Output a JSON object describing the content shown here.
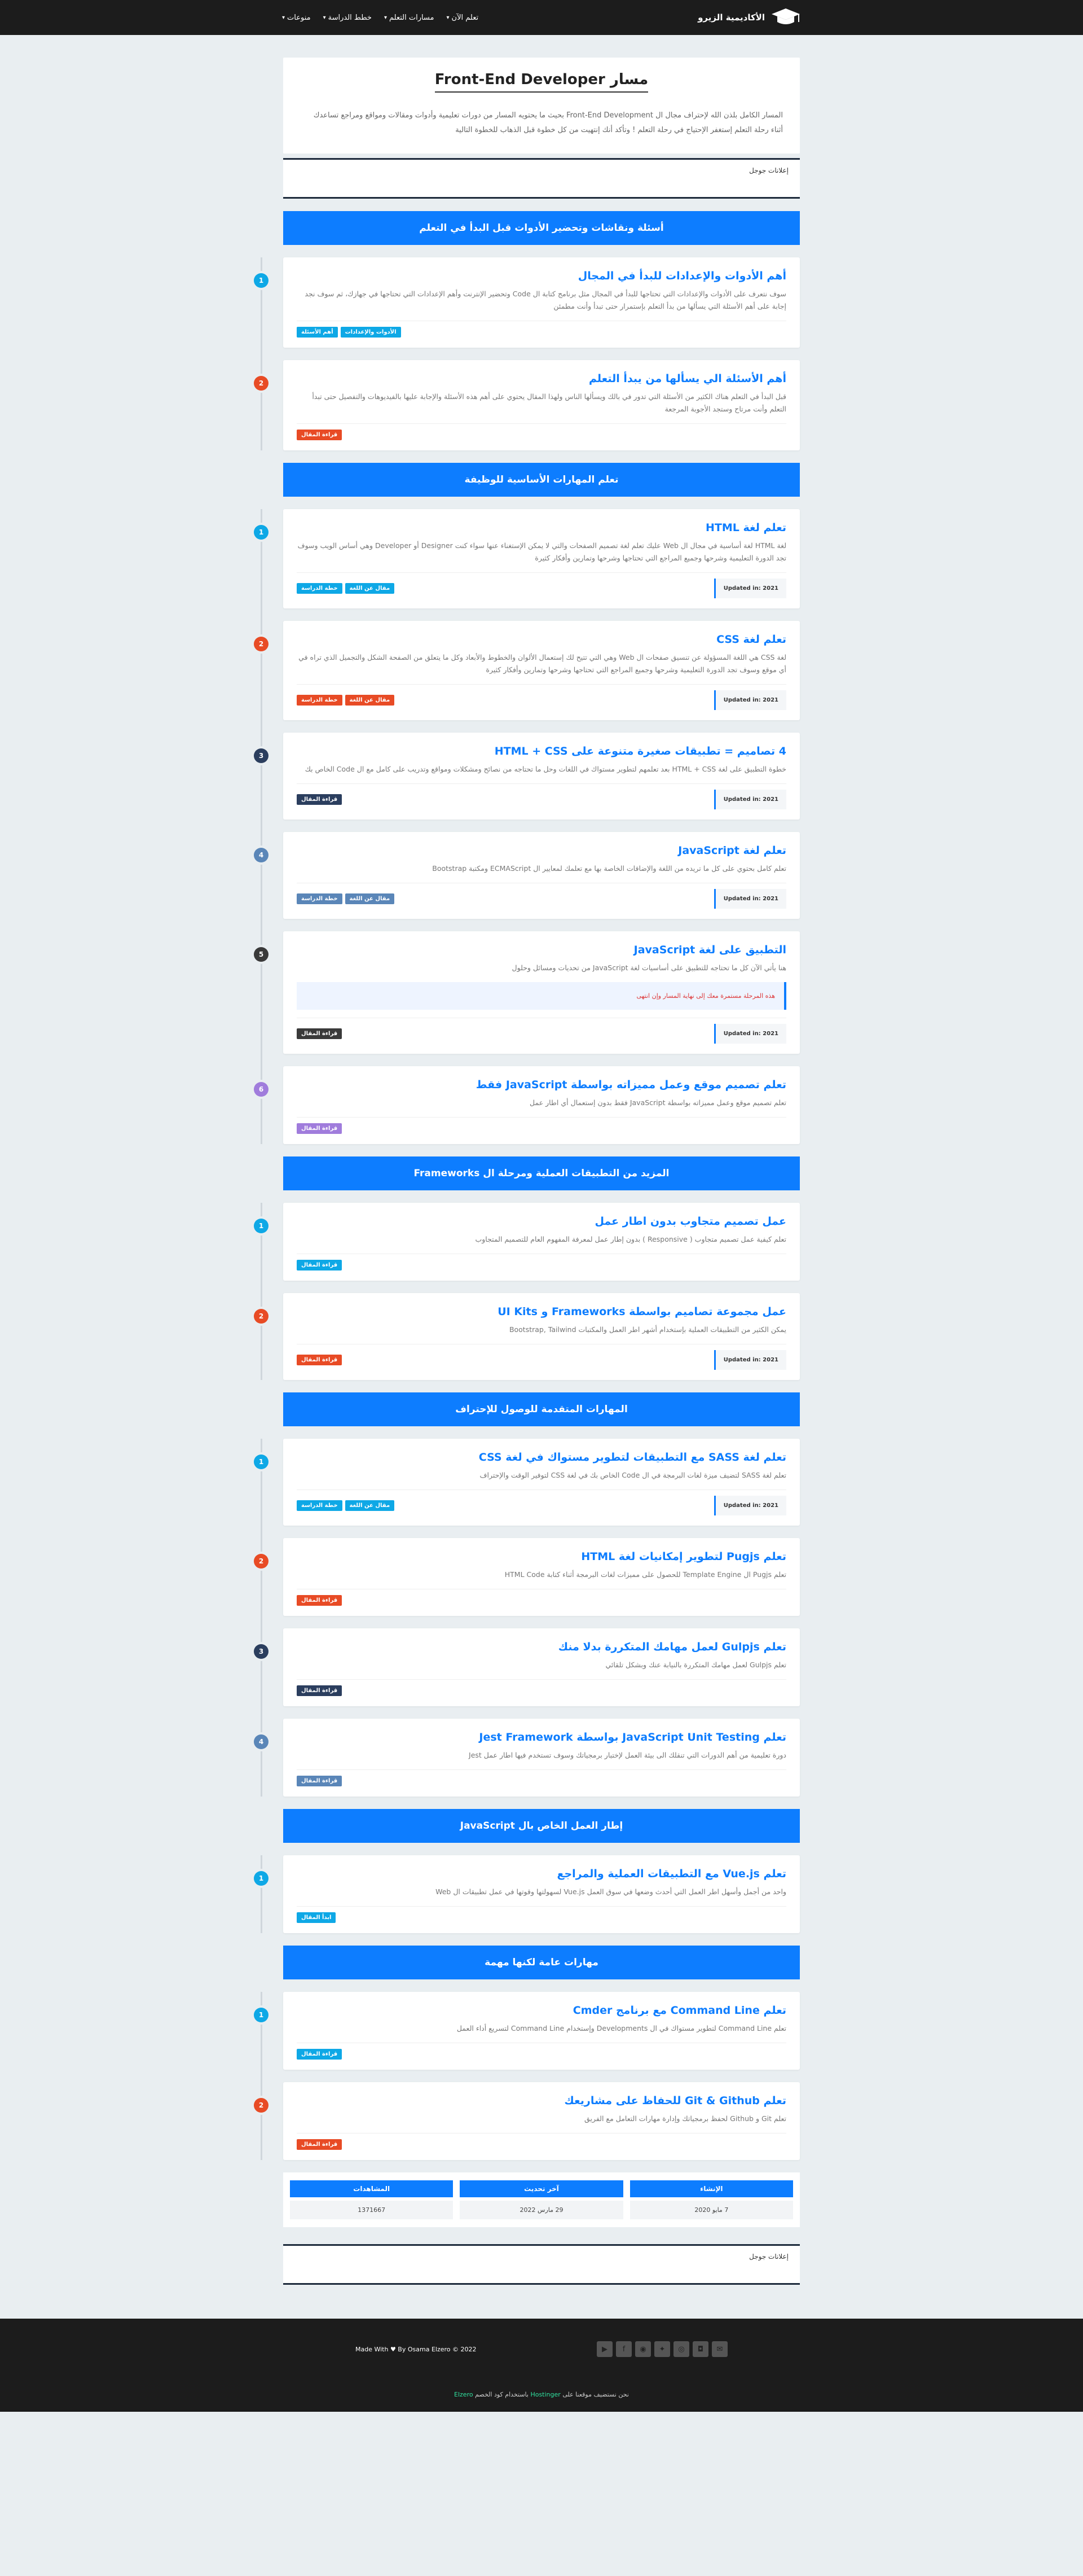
{
  "nav": {
    "brand": "الأكاديمية الزيرو",
    "menu": [
      "تعلم الآن",
      "مسارات التعلم",
      "خطط الدراسة",
      "منوعات"
    ]
  },
  "hero": {
    "title": "Front-End Developer مسار",
    "text": "المسار الكامل بلذن الله لإحتراف مجال ال Front-End Development بحيث ما يحتويه المسار من دورات تعليمية وأدوات ومقالات ومواقع ومراجع تساعدك أثناء رحلة التعلم إستغفر الإحتياج في رحلة التعلم ! وتأكد أنك إنتهيت من كل خطوة قبل الذهاب للخطوة التالية"
  },
  "ads_label": "إعلانات جوجل",
  "colors": {
    "accent": "#0d7dff",
    "c1": "#0ea8e6",
    "c2": "#e84b25",
    "c3": "#2b3e5e",
    "c4": "#5a86b8",
    "c5": "#3a3a3a",
    "c6": "#a07cdc"
  },
  "sections": [
    {
      "title": "أسئلة ونقاشات وتحضير الأدوات قبل البدأ في التعلم",
      "cards": [
        {
          "num": "1",
          "color": "#0ea8e6",
          "title": "أهم الأدوات والإعدادات للبدأ في المجال",
          "text": "سوف نتعرف على الأدوات والإعدادات التي تحتاجها للبدأ في المجال مثل برنامج كتابة ال Code وتحضير الإنترنت وأهم الإعدادات التي تحتاجها في جهازك، ثم سوف نجد إجابة على أهم الأسئلة التي يسألها من بدأ التعلم بإستمرار حتى تبدأ وأنت مطمئن",
          "tags": [
            {
              "label": "الأدوات والإعدادات",
              "color": "#0ea8e6"
            },
            {
              "label": "أهم الأسئلة",
              "color": "#0ea8e6"
            }
          ],
          "updated": ""
        },
        {
          "num": "2",
          "color": "#e84b25",
          "title": "أهم الأسئلة الي يسألها من يبدأ التعلم",
          "text": "قبل البدأ في التعلم هناك الكثير من الأسئلة التي تدور في بالك ويسألها الناس ولهذا المقال يحتوي على أهم هذه الأسئلة والإجابة عليها بالفيديوهات والتفصيل حتى تبدأ التعلم وأنت مرتاح وستجد الأجوبة المرجعة",
          "tags": [
            {
              "label": "قراءة المقال",
              "color": "#e84b25"
            }
          ],
          "updated": ""
        }
      ]
    },
    {
      "title": "تعلم المهارات الأساسية للوظيفة",
      "cards": [
        {
          "num": "1",
          "color": "#0ea8e6",
          "title": "تعلم لغة HTML",
          "text": "لغة HTML لغة أساسية في مجال ال Web عليك تعلم لغة تصميم الصفحات والتي لا يمكن الإستغناء عنها سواء كنت Designer أو Developer وهي أساس الويب وسوف تجد الدورة التعليمية وشرحها وجميع المراجع التي تحتاجها وشرحها وتمارين وأفكار كثيرة",
          "tags": [
            {
              "label": "مقال عن اللغة",
              "color": "#0ea8e6"
            },
            {
              "label": "خطة الدراسة",
              "color": "#0ea8e6"
            }
          ],
          "updated": "Updated in: 2021"
        },
        {
          "num": "2",
          "color": "#e84b25",
          "title": "تعلم لغة CSS",
          "text": "لغة CSS هي اللغة المسؤولة عن تنسيق صفحات ال Web وهي التي تتيح لك إستعمال الألوان والخطوط والأبعاد وكل ما يتعلق من الصفحة الشكل والتجميل الذي تراه في أي موقع وسوف تجد الدورة التعليمية وشرحها وجميع المراجع التي تحتاجها وشرحها وتمارين وأفكار كثيرة",
          "tags": [
            {
              "label": "مقال عن اللغة",
              "color": "#e84b25"
            },
            {
              "label": "خطة الدراسة",
              "color": "#e84b25"
            }
          ],
          "updated": "Updated in: 2021"
        },
        {
          "num": "3",
          "color": "#2b3e5e",
          "title": "4 تصاميم = تطبيقات صغيرة متنوعة على HTML + CSS",
          "text": "خطوة التطبيق على لغة HTML + CSS بعد تعلمهم لتطوير مستواك في اللغات وحل ما تحتاجه من نصائح ومشكلات ومواقع وتدريب على كامل مع ال Code الخاص بك",
          "tags": [
            {
              "label": "قراءة المقال",
              "color": "#2b3e5e"
            }
          ],
          "updated": "Updated in: 2021"
        },
        {
          "num": "4",
          "color": "#5a86b8",
          "title": "تعلم لغة JavaScript",
          "text": "تعلم كامل بحتوي على كل ما تريده من اللغة والإضافات الخاصة بها مع تعلمك لمعايير ال ECMAScript ومكتبة Bootstrap",
          "tags": [
            {
              "label": "مقال عن اللغة",
              "color": "#5a86b8"
            },
            {
              "label": "خطة الدراسة",
              "color": "#5a86b8"
            }
          ],
          "updated": "Updated in: 2021"
        },
        {
          "num": "5",
          "color": "#3a3a3a",
          "title": "التطبيق على لغة JavaScript",
          "text": "هنا يأتي الآن كل ما تحتاجه للتطبيق على أساسيات لغة JavaScript من تحديات ومسائل وحلول",
          "notice": "هذه المرحلة مستمرة معك إلى نهاية المسار وإن انتهى",
          "tags": [
            {
              "label": "قراءة المقال",
              "color": "#3a3a3a"
            }
          ],
          "updated": "Updated in: 2021"
        },
        {
          "num": "6",
          "color": "#a07cdc",
          "title": "تعلم تصميم موقع وعمل مميزاته بواسطة JavaScript فقط",
          "text": "تعلم تصميم موقع وعمل مميزاته بواسطة JavaScript فقط بدون إستعمال أي اطار عمل",
          "tags": [
            {
              "label": "قراءة المقال",
              "color": "#a07cdc"
            }
          ],
          "updated": ""
        }
      ]
    },
    {
      "title": "المزيد من التطبيقات العملية ومرحلة ال Frameworks",
      "cards": [
        {
          "num": "1",
          "color": "#0ea8e6",
          "title": "عمل تصميم متجاوب بدون اطار عمل",
          "text": "تعلم كيفية عمل تصميم متجاوب ( Responsive ) بدون إطار عمل لمعرفة المفهوم العام للتصميم المتجاوب",
          "tags": [
            {
              "label": "قراءة المقال",
              "color": "#0ea8e6"
            }
          ],
          "updated": ""
        },
        {
          "num": "2",
          "color": "#e84b25",
          "title": "عمل مجموعة تصاميم بواسطة Frameworks و UI Kits",
          "text": "يمكن الكثير من التطبيقات العملية بإستخدام أشهر اطر العمل والمكتبات Bootstrap, Tailwind",
          "tags": [
            {
              "label": "قراءة المقال",
              "color": "#e84b25"
            }
          ],
          "updated": "Updated in: 2021"
        }
      ]
    },
    {
      "title": "المهارات المتقدمة للوصول للإحتراف",
      "cards": [
        {
          "num": "1",
          "color": "#0ea8e6",
          "title": "تعلم لغة SASS مع التطبيقات لتطوير مستواك في لغة CSS",
          "text": "تعلم لغة SASS لتضيف ميزة لغات البرمجة في ال Code الخاص بك في لغة CSS لتوفير الوقت والإحتراف",
          "tags": [
            {
              "label": "مقال عن اللغة",
              "color": "#0ea8e6"
            },
            {
              "label": "خطة الدراسة",
              "color": "#0ea8e6"
            }
          ],
          "updated": "Updated in: 2021"
        },
        {
          "num": "2",
          "color": "#e84b25",
          "title": "تعلم Pugjs لتطوير إمكانيات لغة HTML",
          "text": "تعلم Pugjs ال Template Engine للحصول على مميزات لغات البرمجة أثناء كتابة HTML Code",
          "tags": [
            {
              "label": "قراءة المقال",
              "color": "#e84b25"
            }
          ],
          "updated": ""
        },
        {
          "num": "3",
          "color": "#2b3e5e",
          "title": "تعلم Gulpjs لعمل مهامك المتكررة بدلا منك",
          "text": "تعلم Gulpjs لعمل مهامك المتكررة بالنيابة عنك وبشكل تلقائي",
          "tags": [
            {
              "label": "قراءة المقال",
              "color": "#2b3e5e"
            }
          ],
          "updated": ""
        },
        {
          "num": "4",
          "color": "#5a86b8",
          "title": "تعلم JavaScript Unit Testing بواسطة Jest Framework",
          "text": "دورة تعليمية من أهم الدورات التي تنقلك الى بيئة العمل لإختبار برمجياتك وسوف تستخدم فيها اطار عمل Jest",
          "tags": [
            {
              "label": "قراءة المقال",
              "color": "#5a86b8"
            }
          ],
          "updated": ""
        }
      ]
    },
    {
      "title": "إطار العمل الخاص بال JavaScript",
      "cards": [
        {
          "num": "1",
          "color": "#0ea8e6",
          "title": "تعلم Vue.js مع التطبيقات العملية والمراجع",
          "text": "واحد من أجمل وأسهل اطر العمل التي أحدث وضعها في سوق العمل Vue.js لسهولتها وقوتها في عمل تطبيقات ال Web",
          "tags": [
            {
              "label": "ابدأ المقال",
              "color": "#0ea8e6"
            }
          ],
          "updated": ""
        }
      ]
    },
    {
      "title": "مهارات عامة لكنها مهمة",
      "cards": [
        {
          "num": "1",
          "color": "#0ea8e6",
          "title": "تعلم Command Line مع برنامج Cmder",
          "text": "تعلم Command Line لتطوير مستواك في ال Developments وإستخدام Command Line لتسريع أداء العمل",
          "tags": [
            {
              "label": "قراءة المقال",
              "color": "#0ea8e6"
            }
          ],
          "updated": ""
        },
        {
          "num": "2",
          "color": "#e84b25",
          "title": "تعلم Git & Github للحفاظ على مشاريعك",
          "text": "تعلم Git و Github لحفظ برمجياتك وإدارة مهارات التعامل مع الفريق",
          "tags": [
            {
              "label": "قراءة المقال",
              "color": "#e84b25"
            }
          ],
          "updated": ""
        }
      ]
    }
  ],
  "stats": [
    {
      "head": "الإنشاء",
      "value": "7 مايو 2020"
    },
    {
      "head": "آخر تحديث",
      "value": "29 مارس 2022"
    },
    {
      "head": "المشاهدات",
      "value": "1371667"
    }
  ],
  "footer": {
    "made": "Made With ♥ By Osama Elzero © 2022",
    "hosting_prefix": "نحن نستضيف موقعنا على",
    "hosting_mid": "Hostinger",
    "hosting_suffix": "باستخدام كود الخصم",
    "hosting_code": "Elzero",
    "social_icons": [
      "youtube-icon",
      "facebook-icon",
      "github-icon",
      "twitter-icon",
      "discord-icon",
      "instagram-icon",
      "email-icon"
    ]
  }
}
